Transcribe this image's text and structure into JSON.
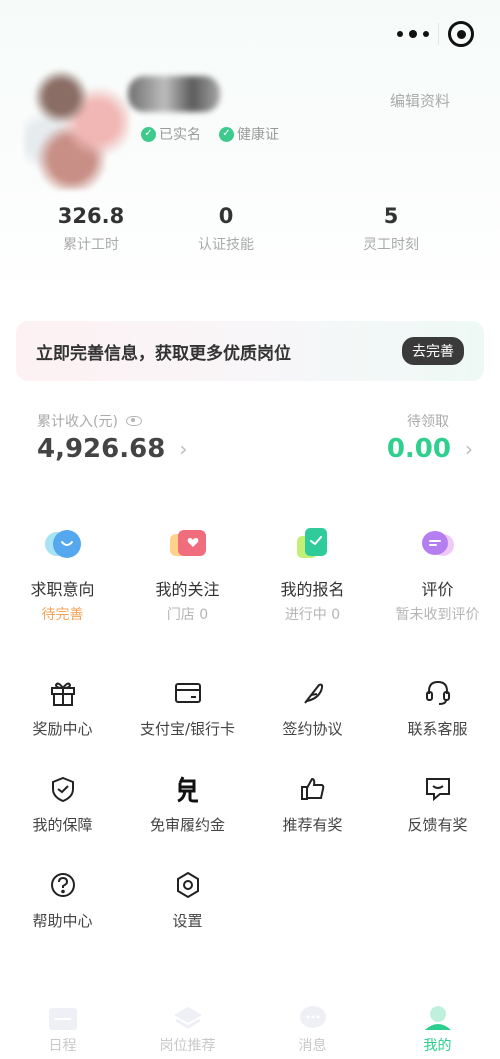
{
  "header": {
    "verified_labels": [
      "已实名",
      "健康证"
    ],
    "edit_profile": "编辑资料"
  },
  "stats": [
    {
      "value": "326.8",
      "label": "累计工时"
    },
    {
      "value": "0",
      "label": "认证技能"
    },
    {
      "value": "5",
      "label": "灵工时刻"
    }
  ],
  "banner": {
    "text": "立即完善信息，获取更多优质岗位",
    "button": "去完善"
  },
  "income": {
    "label": "累计收入(元)",
    "value": "4,926.68",
    "pending_label": "待领取",
    "pending_value": "0.00"
  },
  "features": [
    {
      "name": "求职意向",
      "sub": "待完善",
      "icon": "job-intent-icon"
    },
    {
      "name": "我的关注",
      "sub": "门店 0",
      "icon": "follow-icon"
    },
    {
      "name": "我的报名",
      "sub": "进行中 0",
      "icon": "registration-icon"
    },
    {
      "name": "评价",
      "sub": "暂未收到评价",
      "icon": "review-icon"
    }
  ],
  "grid": [
    {
      "label": "奖励中心",
      "icon": "gift-icon"
    },
    {
      "label": "支付宝/银行卡",
      "icon": "card-icon"
    },
    {
      "label": "签约协议",
      "icon": "feather-icon"
    },
    {
      "label": "联系客服",
      "icon": "headset-icon"
    },
    {
      "label": "我的保障",
      "icon": "shield-icon"
    },
    {
      "label": "免审履约金",
      "icon": "deposit-free-icon"
    },
    {
      "label": "推荐有奖",
      "icon": "thumbs-up-icon"
    },
    {
      "label": "反馈有奖",
      "icon": "feedback-icon"
    },
    {
      "label": "帮助中心",
      "icon": "help-icon"
    },
    {
      "label": "设置",
      "icon": "settings-icon"
    }
  ],
  "tabs": [
    {
      "label": "日程",
      "icon": "calendar-icon"
    },
    {
      "label": "岗位推荐",
      "icon": "jobs-icon"
    },
    {
      "label": "消息",
      "icon": "message-icon"
    },
    {
      "label": "我的",
      "icon": "profile-icon"
    }
  ],
  "colors": {
    "accent": "#2fd08f",
    "warning": "#f6a45a",
    "verified": "#3ec98d"
  }
}
